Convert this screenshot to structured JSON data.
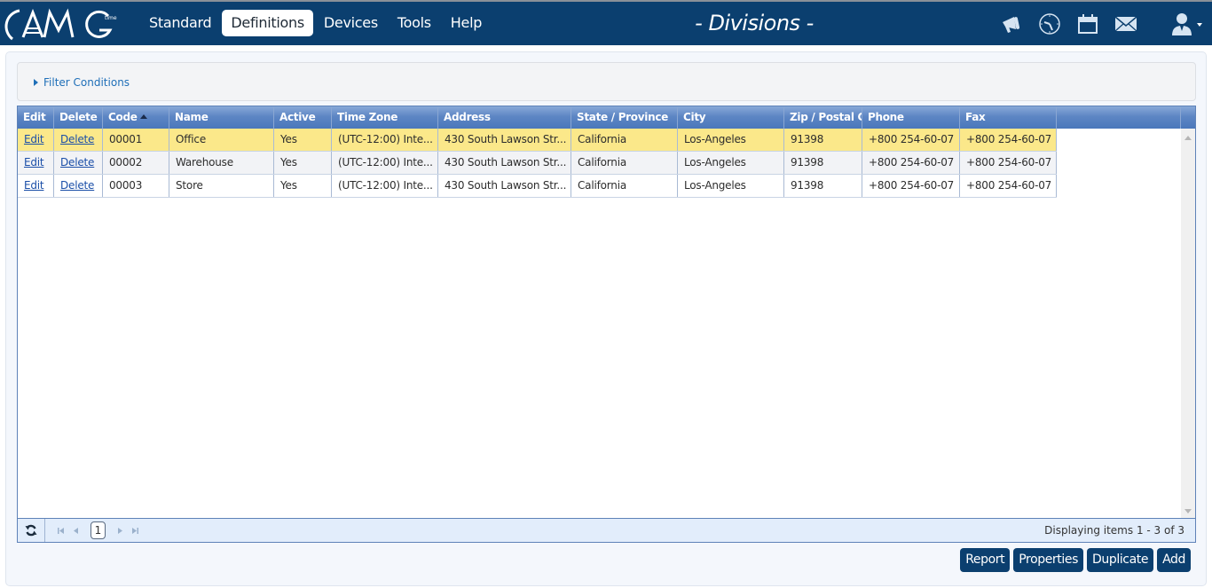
{
  "header": {
    "logo_text": "AMG",
    "logo_sub": "time",
    "nav": [
      {
        "label": "Standard",
        "active": false
      },
      {
        "label": "Definitions",
        "active": true
      },
      {
        "label": "Devices",
        "active": false
      },
      {
        "label": "Tools",
        "active": false
      },
      {
        "label": "Help",
        "active": false
      }
    ],
    "page_title": "- Divisions -",
    "icons": [
      "megaphone-icon",
      "clock-icon",
      "calendar-icon",
      "mail-icon",
      "user-icon"
    ]
  },
  "filter": {
    "label": "Filter Conditions"
  },
  "grid": {
    "columns": [
      "Edit",
      "Delete",
      "Code",
      "Name",
      "Active",
      "Time Zone",
      "Address",
      "State / Province",
      "City",
      "Zip / Postal Co",
      "Phone",
      "Fax"
    ],
    "sorted_column": "Code",
    "sort_direction": "asc",
    "rows": [
      {
        "edit": "Edit",
        "delete": "Delete",
        "code": "00001",
        "name": "Office",
        "active": "Yes",
        "time_zone": "(UTC-12:00) Inte...",
        "address": "430 South Lawson Str...",
        "state": "California",
        "city": "Los-Angeles",
        "zip": "91398",
        "phone": "+800 254-60-07",
        "fax": "+800 254-60-07",
        "selected": true
      },
      {
        "edit": "Edit",
        "delete": "Delete",
        "code": "00002",
        "name": "Warehouse",
        "active": "Yes",
        "time_zone": "(UTC-12:00) Inte...",
        "address": "430 South Lawson Str...",
        "state": "California",
        "city": "Los-Angeles",
        "zip": "91398",
        "phone": "+800 254-60-07",
        "fax": "+800 254-60-07",
        "selected": false
      },
      {
        "edit": "Edit",
        "delete": "Delete",
        "code": "00003",
        "name": "Store",
        "active": "Yes",
        "time_zone": "(UTC-12:00) Inte...",
        "address": "430 South Lawson Str...",
        "state": "California",
        "city": "Los-Angeles",
        "zip": "91398",
        "phone": "+800 254-60-07",
        "fax": "+800 254-60-07",
        "selected": false
      }
    ]
  },
  "pager": {
    "current_page": "1",
    "info": "Displaying items 1 - 3 of 3"
  },
  "actions": {
    "report": "Report",
    "properties": "Properties",
    "duplicate": "Duplicate",
    "add": "Add"
  },
  "colors": {
    "brand": "#0b3f6f",
    "selected_row": "#fbe88a",
    "header_grad": "#5d86c4",
    "link": "#1b4fa8"
  }
}
